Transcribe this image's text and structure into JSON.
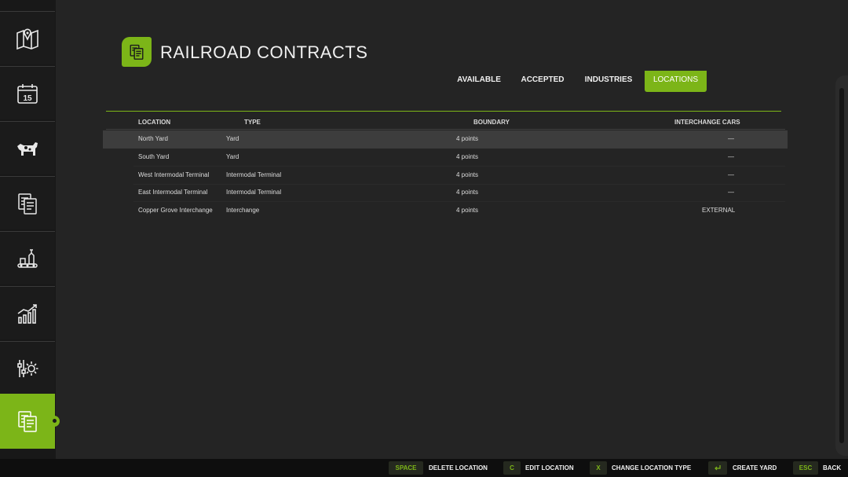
{
  "header": {
    "title": "RAILROAD CONTRACTS",
    "icon": "contracts-icon"
  },
  "sidebar": {
    "items": [
      {
        "icon": "map-icon"
      },
      {
        "icon": "calendar-icon",
        "label": "15"
      },
      {
        "icon": "animals-icon"
      },
      {
        "icon": "contracts-icon"
      },
      {
        "icon": "production-icon"
      },
      {
        "icon": "statistics-icon"
      },
      {
        "icon": "settings-icon"
      },
      {
        "icon": "contracts-icon",
        "active": true
      }
    ]
  },
  "tabs": [
    {
      "label": "AVAILABLE"
    },
    {
      "label": "ACCEPTED"
    },
    {
      "label": "INDUSTRIES"
    },
    {
      "label": "LOCATIONS",
      "active": true
    }
  ],
  "table": {
    "columns": [
      "LOCATION",
      "TYPE",
      "BOUNDARY",
      "INTERCHANGE CARS"
    ],
    "rows": [
      {
        "location": "North Yard",
        "type": "Yard",
        "boundary": "4 points",
        "interchange": "—",
        "selected": true
      },
      {
        "location": "South Yard",
        "type": "Yard",
        "boundary": "4 points",
        "interchange": "—"
      },
      {
        "location": "West Intermodal Terminal",
        "type": "Intermodal Terminal",
        "boundary": "4 points",
        "interchange": "—"
      },
      {
        "location": "East Intermodal Terminal",
        "type": "Intermodal Terminal",
        "boundary": "4 points",
        "interchange": "—"
      },
      {
        "location": "Copper Grove Interchange",
        "type": "Interchange",
        "boundary": "4 points",
        "interchange": "EXTERNAL"
      }
    ]
  },
  "footer": {
    "actions": [
      {
        "key": "SPACE",
        "label": "DELETE LOCATION"
      },
      {
        "key": "C",
        "label": "EDIT LOCATION"
      },
      {
        "key": "X",
        "label": "CHANGE LOCATION TYPE"
      },
      {
        "key_icon": "enter-icon",
        "label": "CREATE YARD"
      },
      {
        "key": "ESC",
        "label": "BACK"
      }
    ]
  },
  "colors": {
    "accent": "#7cb518",
    "background": "#242424",
    "sidebar": "#1b1b1b"
  }
}
